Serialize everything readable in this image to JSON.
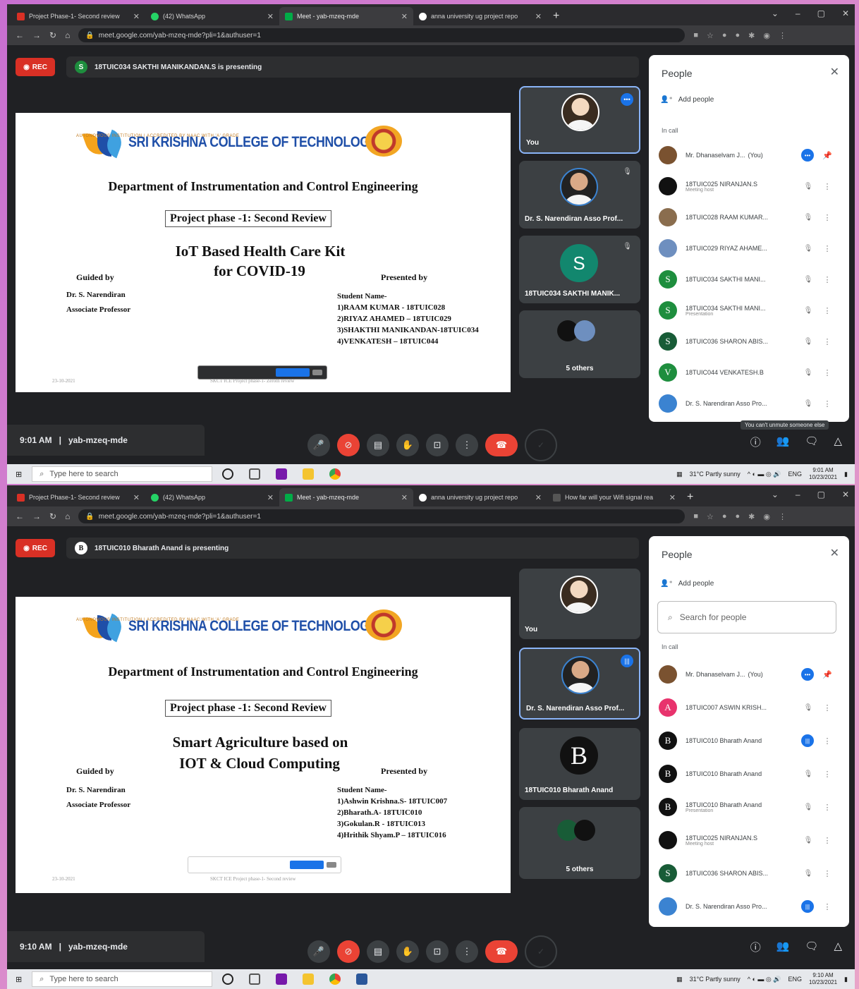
{
  "screens": [
    {
      "tabs": [
        "Project Phase-1- Second review",
        "(42) WhatsApp",
        "Meet - yab-mzeq-mde",
        "anna university ug project repo"
      ],
      "url": "meet.google.com/yab-mzeq-mde?pli=1&authuser=1",
      "presenting": "18TUIC034 SAKTHI MANIKANDAN.S is presenting",
      "presenter_initial": "S",
      "slide": {
        "college": "SRI KRISHNA COLLEGE OF TECHNOLOGY",
        "college_sub": "AUTONOMOUS INSTITUTION | ACCREDITED BY NAAC WITH 'A' GRADE",
        "dept": "Department of Instrumentation and Control Engineering",
        "phase": "Project phase -1: Second Review",
        "title1": "IoT Based Health Care Kit",
        "title2": "for COVID-19",
        "guided_by": "Guided by",
        "guide_name": "Dr. S. Narendiran",
        "guide_role": "Associate Professor",
        "presented_by": "Presented by",
        "student_header": "Student Name-",
        "students": [
          "1)RAAM KUMAR - 18TUIC028",
          "2)RIYAZ AHAMED – 18TUIC029",
          "3)SHAKTHI MANIKANDAN-18TUIC034",
          "4)VENKATESH – 18TUIC044"
        ],
        "date": "23-10-2021",
        "footer": "SKCT ICE Project phase-1- Zeroth review"
      },
      "tiles": [
        "You",
        "Dr. S. Narendiran Asso Prof...",
        "18TUIC034 SAKTHI MANIK...",
        "5 others"
      ],
      "tile_initial": "S",
      "people": {
        "title": "People",
        "add": "Add people",
        "in_call": "In call",
        "rows": [
          {
            "name": "Mr. Dhanaselvam J...",
            "you": "(You)",
            "sub": "",
            "initial": "",
            "color": "#7a5230"
          },
          {
            "name": "18TUIC025 NIRANJAN.S",
            "sub": "Meeting host",
            "initial": "",
            "color": "#111111"
          },
          {
            "name": "18TUIC028 RAAM KUMAR...",
            "sub": "",
            "initial": "",
            "color": "#8a6d4e"
          },
          {
            "name": "18TUIC029 RIYAZ AHAME...",
            "sub": "",
            "initial": "",
            "color": "#6e8fbf"
          },
          {
            "name": "18TUIC034 SAKTHI MANI...",
            "sub": "",
            "initial": "S",
            "color": "#1e8e3e"
          },
          {
            "name": "18TUIC034 SAKTHI MANI...",
            "sub": "Presentation",
            "initial": "S",
            "color": "#1e8e3e"
          },
          {
            "name": "18TUIC036 SHARON ABIS...",
            "sub": "",
            "initial": "S",
            "color": "#185c37"
          },
          {
            "name": "18TUIC044 VENKATESH.B",
            "sub": "",
            "initial": "V",
            "color": "#1e8e3e"
          },
          {
            "name": "Dr. S. Narendiran Asso Pro...",
            "sub": "",
            "initial": "",
            "color": "#3b83d1"
          }
        ]
      },
      "tooltip": "You can't unmute someone else",
      "time": "9:01 AM",
      "code": "yab-mzeq-mde",
      "task_search": "Type here to search",
      "weather": "31°C Partly sunny",
      "lang": "ENG",
      "clock_time": "9:01 AM",
      "clock_date": "10/23/2021"
    },
    {
      "tabs": [
        "Project Phase-1- Second review",
        "(42) WhatsApp",
        "Meet - yab-mzeq-mde",
        "anna university ug project repo",
        "How far will your Wifi signal rea"
      ],
      "url": "meet.google.com/yab-mzeq-mde?pli=1&authuser=1",
      "presenting": "18TUIC010 Bharath Anand is presenting",
      "presenter_initial": "B",
      "slide": {
        "college": "SRI KRISHNA COLLEGE OF TECHNOLOGY",
        "college_sub": "AUTONOMOUS INSTITUTION | ACCREDITED BY NAAC WITH 'A' GRADE",
        "dept": "Department of Instrumentation and Control Engineering",
        "phase": "Project phase -1: Second Review",
        "title1": "Smart Agriculture based on",
        "title2": "IOT & Cloud Computing",
        "guided_by": "Guided by",
        "guide_name": "Dr. S. Narendiran",
        "guide_role": "Associate Professor",
        "presented_by": "Presented by",
        "student_header": "Student Name-",
        "students": [
          "1)Ashwin Krishna.S- 18TUIC007",
          "2)Bharath.A- 18TUIC010",
          "3)Gokulan.R - 18TUIC013",
          "4)Hrithik Shyam.P – 18TUIC016"
        ],
        "date": "23-10-2021",
        "footer": "SKCT ICE Project phase-1- Second review"
      },
      "tiles": [
        "You",
        "Dr. S. Narendiran Asso Prof...",
        "18TUIC010 Bharath Anand",
        "5 others"
      ],
      "tile_initial": "B",
      "people": {
        "title": "People",
        "add": "Add people",
        "search": "Search for people",
        "in_call": "In call",
        "rows": [
          {
            "name": "Mr. Dhanaselvam J...",
            "you": "(You)",
            "sub": "",
            "initial": "",
            "color": "#7a5230"
          },
          {
            "name": "18TUIC007 ASWIN KRISH...",
            "sub": "",
            "initial": "A",
            "color": "#e8336d"
          },
          {
            "name": "18TUIC010 Bharath Anand",
            "sub": "",
            "initial": "B",
            "color": "#111111"
          },
          {
            "name": "18TUIC010 Bharath Anand",
            "sub": "",
            "initial": "B",
            "color": "#111111"
          },
          {
            "name": "18TUIC010 Bharath Anand",
            "sub": "Presentation",
            "initial": "B",
            "color": "#111111"
          },
          {
            "name": "18TUIC025 NIRANJAN.S",
            "sub": "Meeting host",
            "initial": "",
            "color": "#111111"
          },
          {
            "name": "18TUIC036 SHARON ABIS...",
            "sub": "",
            "initial": "S",
            "color": "#185c37"
          },
          {
            "name": "Dr. S. Narendiran Asso Pro...",
            "sub": "",
            "initial": "",
            "color": "#3b83d1"
          }
        ]
      },
      "time": "9:10 AM",
      "code": "yab-mzeq-mde",
      "task_search": "Type here to search",
      "weather": "31°C Partly sunny",
      "lang": "ENG",
      "clock_time": "9:10 AM",
      "clock_date": "10/23/2021"
    }
  ],
  "colors": {
    "meet_bg": "#202124",
    "accent": "#1a73e8",
    "danger": "#ea4335",
    "rec": "#d93025"
  }
}
